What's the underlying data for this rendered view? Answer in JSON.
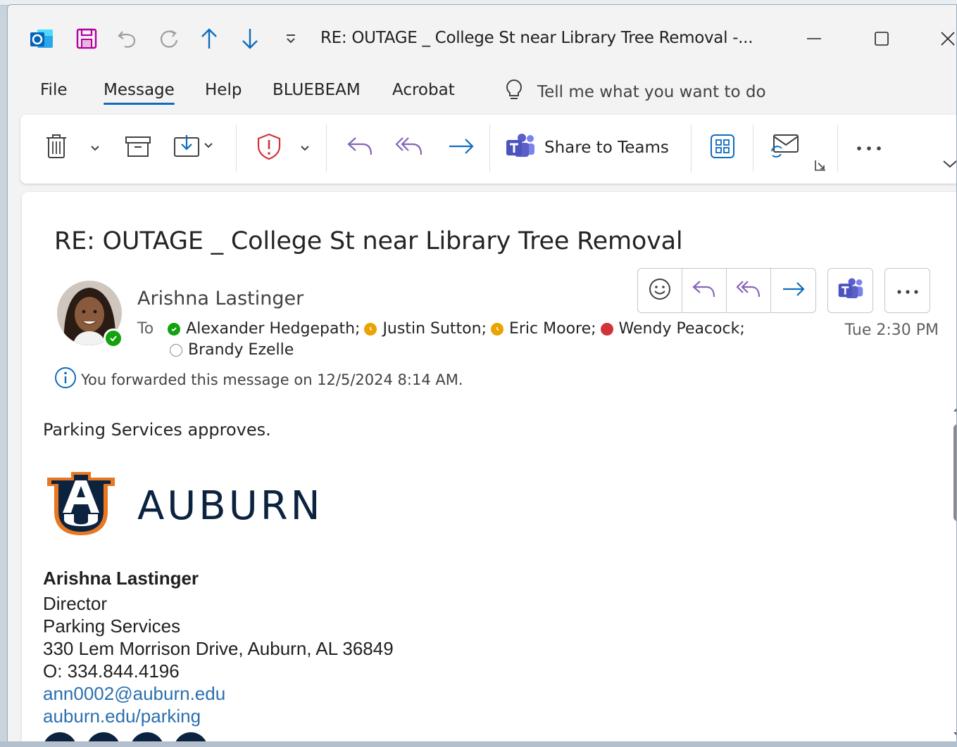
{
  "window": {
    "title": "RE: OUTAGE _ College St near Library Tree Removal -..."
  },
  "menu": {
    "items": [
      "File",
      "Message",
      "Help",
      "BLUEBEAM",
      "Acrobat"
    ],
    "active": "Message",
    "search_placeholder": "Tell me what you want to do"
  },
  "ribbon": {
    "share_teams_label": "Share to Teams"
  },
  "message": {
    "subject": "RE: OUTAGE _ College St near Library Tree Removal",
    "sender": "Arishna Lastinger",
    "to_label": "To",
    "recipients": [
      {
        "name": "Alexander Hedgepath;",
        "status": "available",
        "color": "#13a10e"
      },
      {
        "name": "Justin Sutton;",
        "status": "away",
        "color": "#eaa300"
      },
      {
        "name": "Eric Moore;",
        "status": "away",
        "color": "#eaa300"
      },
      {
        "name": "Wendy Peacock;",
        "status": "busy",
        "color": "#d13438"
      },
      {
        "name": "Brandy Ezelle",
        "status": "offline",
        "color": "#ffffff"
      }
    ],
    "time": "Tue 2:30 PM",
    "info_notice": "You forwarded this message on 12/5/2024 8:14 AM.",
    "body": "Parking Services approves."
  },
  "signature": {
    "logo_word": "AUBURN",
    "name": "Arishna Lastinger",
    "title": "Director",
    "department": "Parking Services",
    "address": "330 Lem Morrison Drive, Auburn, AL 36849",
    "phone": "O: 334.844.4196",
    "email": "ann0002@auburn.edu",
    "website": "auburn.edu/parking"
  },
  "colors": {
    "accent": "#0f6cbd",
    "auburn_navy": "#0c2340",
    "auburn_orange": "#e87722",
    "teams_purple": "#5b5fc7",
    "link": "#2a6fb0"
  }
}
